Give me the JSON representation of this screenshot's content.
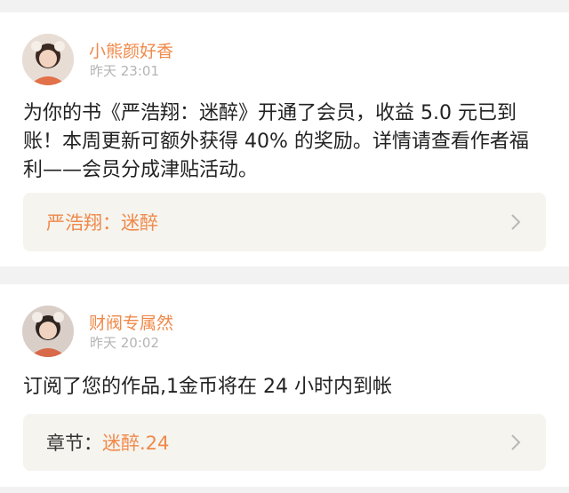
{
  "notifications": [
    {
      "username": "小熊颜好香",
      "timestamp": "昨天 23:01",
      "message": "为你的书《严浩翔：迷醉》开通了会员，收益 5.0 元已到账！本周更新可额外获得 40% 的奖励。详情请查看作者福利——会员分成津贴活动。",
      "link": {
        "prefix": "",
        "title": "严浩翔：迷醉"
      },
      "icons": {
        "avatar": "user-avatar-icon",
        "chevron": "chevron-right-icon"
      }
    },
    {
      "username": "财阀专属然",
      "timestamp": "昨天 20:02",
      "message": "订阅了您的作品,1金币将在 24 小时内到帐",
      "link": {
        "prefix": "章节：",
        "title": "迷醉.24"
      },
      "icons": {
        "avatar": "user-avatar-icon",
        "chevron": "chevron-right-icon"
      }
    }
  ],
  "colors": {
    "accent": "#f0894a",
    "page_background": "#f2f2f2",
    "card_background": "#ffffff",
    "link_box_background": "#f5f4ef",
    "timestamp": "#b4b4b4",
    "body_text": "#222222"
  }
}
